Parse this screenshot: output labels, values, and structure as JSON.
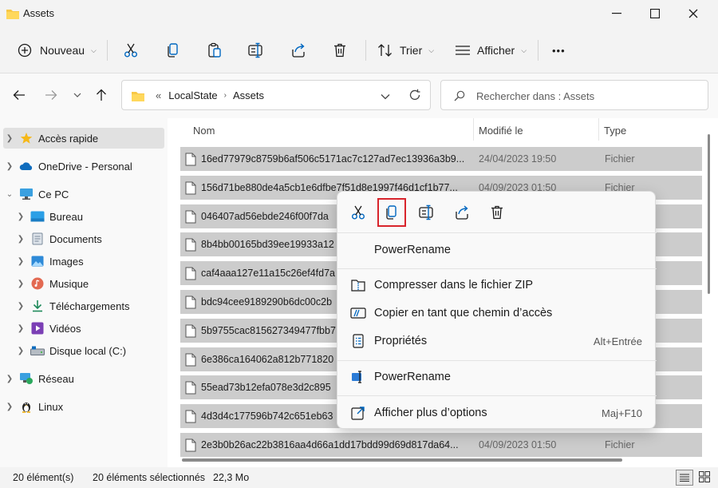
{
  "window": {
    "title": "Assets"
  },
  "command_bar": {
    "new_label": "Nouveau",
    "sort_label": "Trier",
    "view_label": "Afficher",
    "more_label": "•••"
  },
  "address": {
    "overflow": "«",
    "crumbs": [
      "LocalState",
      "Assets"
    ]
  },
  "search": {
    "placeholder": "Rechercher dans : Assets"
  },
  "sidebar": {
    "items": [
      {
        "label": "Accès rapide"
      },
      {
        "label": "OneDrive - Personal"
      },
      {
        "label": "Ce PC"
      },
      {
        "label": "Bureau"
      },
      {
        "label": "Documents"
      },
      {
        "label": "Images"
      },
      {
        "label": "Musique"
      },
      {
        "label": "Téléchargements"
      },
      {
        "label": "Vidéos"
      },
      {
        "label": "Disque local (C:)"
      },
      {
        "label": "Réseau"
      },
      {
        "label": "Linux"
      }
    ]
  },
  "columns": {
    "name": "Nom",
    "modified": "Modifié le",
    "type": "Type"
  },
  "files": [
    {
      "name": "16ed77979c8759b6af506c5171ac7c127ad7ec13936a3b9...",
      "date": "24/04/2023 19:50",
      "type": "Fichier"
    },
    {
      "name": "156d71be880de4a5cb1e6dfbe7f51d8e1997f46d1cf1b77...",
      "date": "04/09/2023 01:50",
      "type": "Fichier"
    },
    {
      "name": "046407ad56ebde246f00f7da",
      "date": "",
      "type": ""
    },
    {
      "name": "8b4bb00165bd39ee19933a12",
      "date": "",
      "type": ""
    },
    {
      "name": "caf4aaa127e11a15c26ef4fd7a",
      "date": "",
      "type": ""
    },
    {
      "name": "bdc94cee9189290b6dc00c2b",
      "date": "",
      "type": ""
    },
    {
      "name": "5b9755cac815627349477fbb7",
      "date": "",
      "type": ""
    },
    {
      "name": "6e386ca164062a812b771820",
      "date": "",
      "type": ""
    },
    {
      "name": "55ead73b12efa078e3d2c895",
      "date": "",
      "type": ""
    },
    {
      "name": "4d3d4c177596b742c651eb63",
      "date": "",
      "type": ""
    },
    {
      "name": "2e3b0b26ac22b3816aa4d66a1dd17bdd99d69d817da64...",
      "date": "04/09/2023 01:50",
      "type": "Fichier"
    }
  ],
  "context_menu": {
    "power_rename_top": "PowerRename",
    "compress": "Compresser dans le fichier ZIP",
    "copy_path": "Copier en tant que chemin d’accès",
    "properties": "Propriétés",
    "properties_shortcut": "Alt+Entrée",
    "power_rename": "PowerRename",
    "more_options": "Afficher plus d’options",
    "more_options_shortcut": "Maj+F10"
  },
  "status": {
    "count": "20 élément(s)",
    "selected": "20 éléments sélectionnés",
    "size": "22,3 Mo"
  },
  "colors": {
    "accent": "#0067c0",
    "highlight": "#d8242c",
    "selection": "#cccccc"
  }
}
